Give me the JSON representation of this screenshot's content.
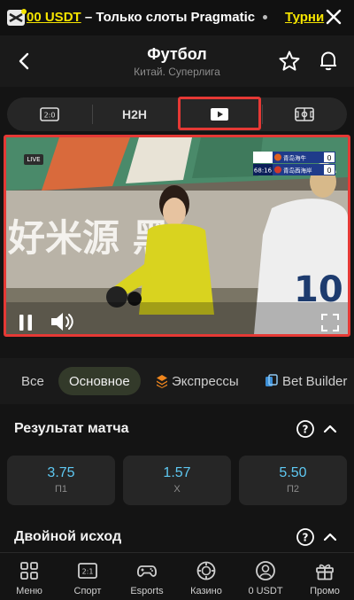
{
  "promo": {
    "amount": "00 USDT",
    "text": " – Только слоты Pragmatic",
    "right_text": "Турни"
  },
  "header": {
    "title": "Футбол",
    "subtitle": "Китай. Суперлига"
  },
  "media_tabs": [
    {
      "label": "2:0",
      "icon": "scoreboard-icon"
    },
    {
      "label": "H2H"
    },
    {
      "icon": "play-icon",
      "active": true
    },
    {
      "icon": "field-icon"
    }
  ],
  "video": {
    "live_label": "LIVE",
    "clock": "68:16",
    "team1": "青岛海牛",
    "team2": "青岛西海岸",
    "score1": "0",
    "score2": "0",
    "banner_text": "好米源 黑"
  },
  "market_filters": [
    {
      "label": "Все",
      "active": false
    },
    {
      "label": "Основное",
      "active": true
    },
    {
      "label": "Экспрессы",
      "icon": "layers-icon",
      "active": false
    },
    {
      "label": "Bet Builder",
      "icon": "builder-icon",
      "active": false
    }
  ],
  "sections": {
    "match_result": {
      "title": "Результат матча",
      "odds": [
        {
          "value": "3.75",
          "label": "П1"
        },
        {
          "value": "1.57",
          "label": "X"
        },
        {
          "value": "5.50",
          "label": "П2"
        }
      ]
    },
    "double_chance": {
      "title": "Двойной исход"
    }
  },
  "bottom_nav": [
    {
      "label": "Меню",
      "icon": "grid-icon"
    },
    {
      "label": "Спорт",
      "icon": "sport-icon",
      "icon_text": "2:1"
    },
    {
      "label": "Esports",
      "icon": "gamepad-icon"
    },
    {
      "label": "Казино",
      "icon": "casino-chip-icon"
    },
    {
      "label": "0 USDT",
      "icon": "user-icon"
    },
    {
      "label": "Промо",
      "icon": "gift-icon"
    }
  ],
  "colors": {
    "accent_yellow": "#f5e400",
    "odds_blue": "#5ec8f2",
    "highlight_red": "#e53935"
  }
}
